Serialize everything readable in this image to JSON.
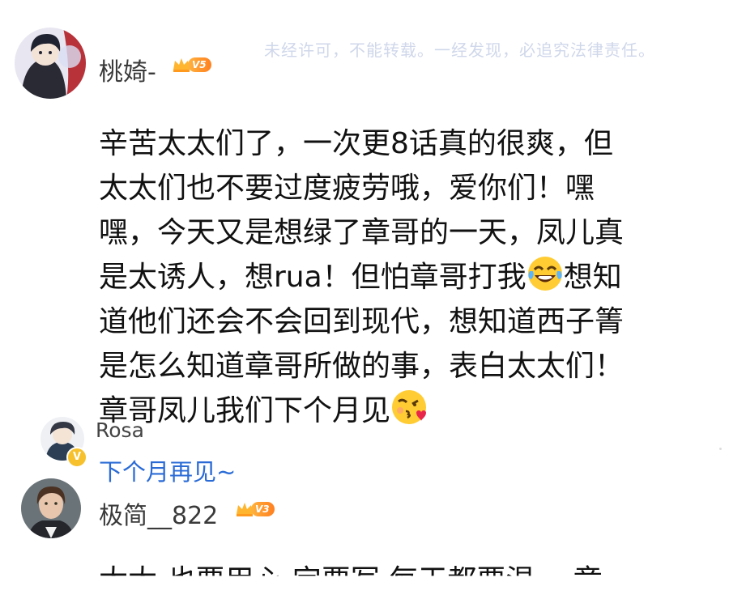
{
  "watermark": "未经许可，不能转载。一经发现，必追究法律责任。",
  "post": {
    "author": "桃婍-",
    "vip_level": "V5",
    "lines": [
      "辛苦太太们了，一次更8话真的很爽，但",
      "太太们也不要过度疲劳哦，爱你们！嘿",
      "嘿，今天又是想绿了章哥的一天，凤儿真",
      {
        "before": "是太诱人，想rua！但怕章哥打我",
        "emoji": "laughing-tears-emoji",
        "after": "想知"
      },
      "道他们还会不会回到现代，想知道西子箐",
      "是怎么知道章哥所做的事，表白太太们！",
      {
        "before": "章哥凤儿我们下个月见",
        "emoji": "kissing-heart-emoji",
        "after": ""
      }
    ]
  },
  "reply": {
    "author": "Rosa",
    "badge": "V",
    "text": "下个月再见~"
  },
  "next_comment": {
    "author": "极简__822",
    "vip_level": "V3",
    "partial_text": "太太 也要用心 定要写 每天都要温一 章"
  },
  "colors": {
    "watermark": "#cfd7ea",
    "reply_link": "#2a6bd6",
    "vip_badge": "#ff8a26"
  }
}
